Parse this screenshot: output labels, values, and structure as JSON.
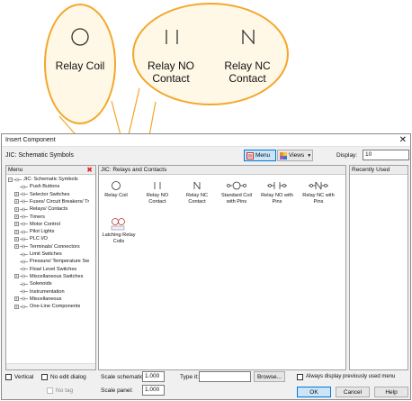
{
  "callouts": {
    "relay_coil": "Relay Coil",
    "relay_no": "Relay NO\nContact",
    "relay_nc": "Relay NC\nContact"
  },
  "dialog": {
    "title": "Insert Component",
    "close_glyph": "✕",
    "library": "JIC: Schematic Symbols",
    "menu_button": "Menu",
    "views_button": "Views",
    "display_label": "Display:",
    "display_value": "10"
  },
  "menu_pane": {
    "header": "Menu",
    "close_glyph": "✖",
    "items": [
      {
        "label": "JIC: Schematic Symbols",
        "level": 0,
        "expander": "−"
      },
      {
        "label": "Push Buttons",
        "level": 1,
        "expander": ""
      },
      {
        "label": "Selector Switches",
        "level": 1,
        "expander": "+"
      },
      {
        "label": "Fuses/ Circuit Breakers/ Tr",
        "level": 1,
        "expander": "+"
      },
      {
        "label": "Relays/ Contacts",
        "level": 1,
        "expander": "+"
      },
      {
        "label": "Timers",
        "level": 1,
        "expander": "+"
      },
      {
        "label": "Motor Control",
        "level": 1,
        "expander": "+"
      },
      {
        "label": "Pilot Lights",
        "level": 1,
        "expander": "+"
      },
      {
        "label": "PLC I/O",
        "level": 1,
        "expander": "+"
      },
      {
        "label": "Terminals/ Connectors",
        "level": 1,
        "expander": "+"
      },
      {
        "label": "Limit Switches",
        "level": 1,
        "expander": ""
      },
      {
        "label": "Pressure/ Temperature Sw",
        "level": 1,
        "expander": ""
      },
      {
        "label": "Flow/ Level Switches",
        "level": 1,
        "expander": ""
      },
      {
        "label": "Miscellaneous Switches",
        "level": 1,
        "expander": "+"
      },
      {
        "label": "Solenoids",
        "level": 1,
        "expander": ""
      },
      {
        "label": "Instrumentation",
        "level": 1,
        "expander": ""
      },
      {
        "label": "Miscellaneous",
        "level": 1,
        "expander": "+"
      },
      {
        "label": "One-Line Components",
        "level": 1,
        "expander": "+"
      }
    ]
  },
  "center_pane": {
    "header": "JIC: Relays and Contacts",
    "components": [
      {
        "label": "Relay Coil",
        "icon": "relay-coil-icon"
      },
      {
        "label": "Relay NO\nContact",
        "icon": "relay-no-icon"
      },
      {
        "label": "Relay NC\nContact",
        "icon": "relay-nc-icon"
      },
      {
        "label": "Standard Coil\nwith Pins",
        "icon": "coil-pins-icon"
      },
      {
        "label": "Relay NO with\nPins",
        "icon": "no-pins-icon"
      },
      {
        "label": "Relay NC with\nPins",
        "icon": "nc-pins-icon"
      },
      {
        "label": "Latching Relay\nCoils",
        "icon": "latching-relay-icon"
      }
    ]
  },
  "recent_pane": {
    "header": "Recently Used"
  },
  "footer": {
    "vertical": "Vertical",
    "no_edit": "No edit dialog",
    "no_tag": "No tag",
    "scale_schematic_label": "Scale schematic:",
    "scale_schematic_value": "1.000",
    "scale_panel_label": "Scale panel:",
    "scale_panel_value": "1.000",
    "type_it_label": "Type it:",
    "type_it_value": "",
    "browse": "Browse...",
    "always_display": "Always display previously used menu",
    "ok": "OK",
    "cancel": "Cancel",
    "help": "Help"
  },
  "colors": {
    "callout": "#f3a72a",
    "accent": "#0078d7"
  }
}
